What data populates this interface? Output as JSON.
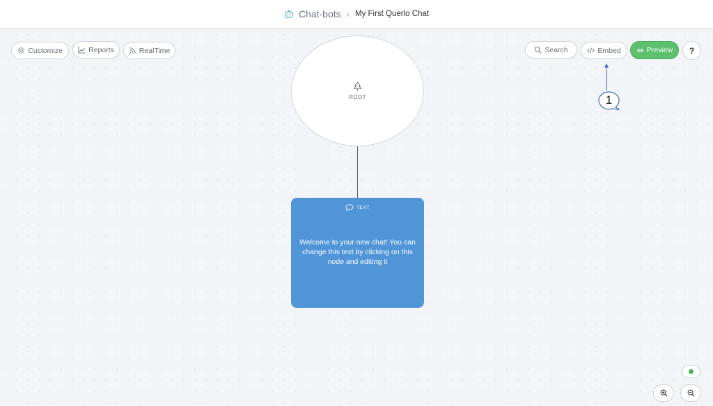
{
  "breadcrumb": {
    "root_icon": "robot-icon",
    "root": "Chat-bots",
    "separator_icon": "chevron-right-icon",
    "current": "My First Querlo Chat"
  },
  "toolbar_left": {
    "customize": {
      "label": "Customize",
      "icon": "gear-icon"
    },
    "reports": {
      "label": "Reports",
      "icon": "chart-line-icon"
    },
    "realtime": {
      "label": "RealTime",
      "icon": "rss-icon"
    }
  },
  "toolbar_right": {
    "search": {
      "label": "Search",
      "icon": "search-icon"
    },
    "embed": {
      "label": "Embed",
      "icon": "code-icon"
    },
    "preview": {
      "label": "Preview",
      "icon": "eye-icon"
    },
    "help": {
      "label": "?"
    }
  },
  "nodes": {
    "root": {
      "label": "ROOT",
      "icon": "tree-icon"
    },
    "text": {
      "type_label": "TEXT",
      "icon": "speech-bubble-icon",
      "body": "Welcome to your new chat! You can change this text by clicking on this node and editing it"
    }
  },
  "annotation": {
    "number": "1"
  },
  "colors": {
    "accent_green": "#5cc06d",
    "node_blue": "#5095d8",
    "status_green": "#4bb05c",
    "annotation_blue": "#3d6fb6"
  }
}
